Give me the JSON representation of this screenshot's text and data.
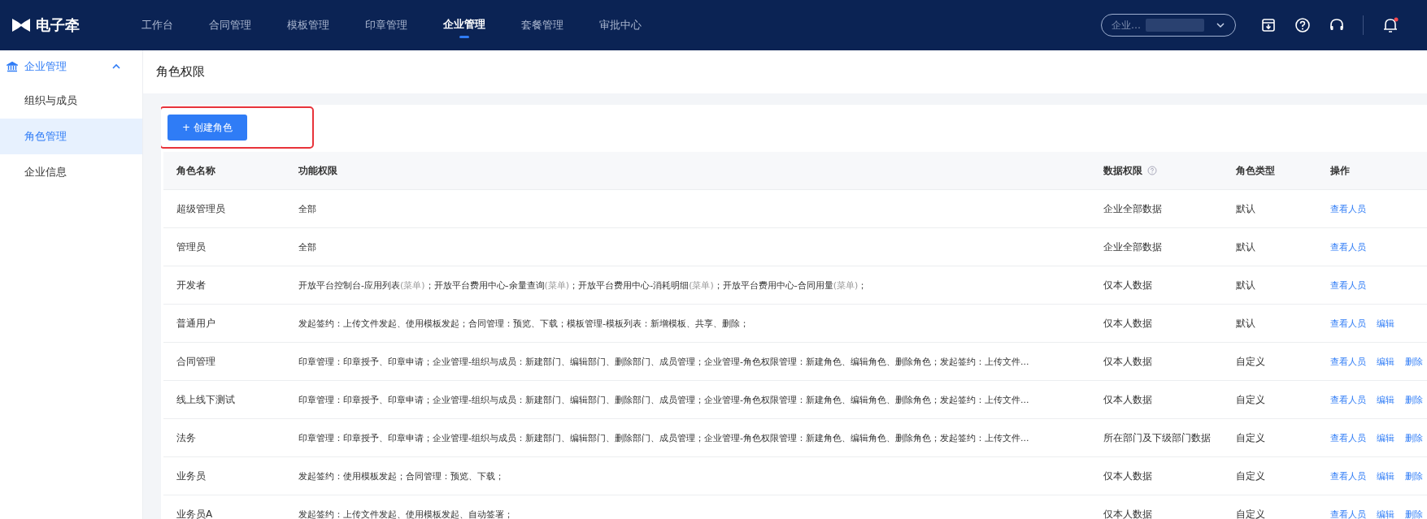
{
  "brand": {
    "name": "电子牵"
  },
  "nav": [
    {
      "label": "工作台",
      "selected": false
    },
    {
      "label": "合同管理",
      "selected": false
    },
    {
      "label": "模板管理",
      "selected": false
    },
    {
      "label": "印章管理",
      "selected": false
    },
    {
      "label": "企业管理",
      "selected": true
    },
    {
      "label": "套餐管理",
      "selected": false
    },
    {
      "label": "审批中心",
      "selected": false
    }
  ],
  "company_selector": {
    "value": "企业…"
  },
  "notifications": {
    "unread": true
  },
  "sidebar": {
    "group": {
      "label": "企业管理",
      "expanded": true,
      "children": [
        {
          "label": "组织与成员",
          "selected": false
        },
        {
          "label": "角色管理",
          "selected": true
        },
        {
          "label": "企业信息",
          "selected": false
        }
      ]
    }
  },
  "page_title": "角色权限",
  "create_button": {
    "label": "+ 创建角色",
    "highlighted": true
  },
  "table": {
    "columns": [
      {
        "label": "角色名称"
      },
      {
        "label": "功能权限"
      },
      {
        "label": "数据权限",
        "help": true
      },
      {
        "label": "角色类型"
      },
      {
        "label": "操作"
      }
    ],
    "rows": [
      {
        "name": "超级管理员",
        "permissions": [
          {
            "kind": "text",
            "text": "全部"
          }
        ],
        "data_scope": "企业全部数据",
        "type": "默认",
        "actions": [
          "查看人员"
        ]
      },
      {
        "name": "管理员",
        "permissions": [
          {
            "kind": "text",
            "text": "全部"
          }
        ],
        "data_scope": "企业全部数据",
        "type": "默认",
        "actions": [
          "查看人员"
        ]
      },
      {
        "name": "开发者",
        "permissions": [
          {
            "kind": "text",
            "text": "开放平台控制台-应用列表"
          },
          {
            "kind": "tag",
            "text": "(菜单)"
          },
          {
            "kind": "text",
            "text": "；开放平台费用中心-余量查询"
          },
          {
            "kind": "tag",
            "text": "(菜单)"
          },
          {
            "kind": "text",
            "text": "；开放平台费用中心-消耗明细"
          },
          {
            "kind": "tag",
            "text": "(菜单)"
          },
          {
            "kind": "text",
            "text": "；开放平台费用中心-合同用量"
          },
          {
            "kind": "tag",
            "text": "(菜单)"
          },
          {
            "kind": "text",
            "text": "；"
          }
        ],
        "data_scope": "仅本人数据",
        "type": "默认",
        "actions": [
          "查看人员"
        ]
      },
      {
        "name": "普通用户",
        "permissions": [
          {
            "kind": "text",
            "text": "发起签约：上传文件发起、使用模板发起；合同管理：预览、下载；模板管理-模板列表：新增模板、共享、删除；"
          }
        ],
        "data_scope": "仅本人数据",
        "type": "默认",
        "actions": [
          "查看人员",
          "编辑"
        ]
      },
      {
        "name": "合同管理",
        "permissions": [
          {
            "kind": "text",
            "text": "印章管理：印章授予、印章申请；企业管理-组织与成员：新建部门、编辑部门、删除部门、成员管理；企业管理-角色权限管理：新建角色、编辑角色、删除角色；发起签约：上传文件..."
          }
        ],
        "data_scope": "仅本人数据",
        "type": "自定义",
        "actions": [
          "查看人员",
          "编辑",
          "删除"
        ]
      },
      {
        "name": "线上线下测试",
        "permissions": [
          {
            "kind": "text",
            "text": "印章管理：印章授予、印章申请；企业管理-组织与成员：新建部门、编辑部门、删除部门、成员管理；企业管理-角色权限管理：新建角色、编辑角色、删除角色；发起签约：上传文件..."
          }
        ],
        "data_scope": "仅本人数据",
        "type": "自定义",
        "actions": [
          "查看人员",
          "编辑",
          "删除"
        ]
      },
      {
        "name": "法务",
        "permissions": [
          {
            "kind": "text",
            "text": "印章管理：印章授予、印章申请；企业管理-组织与成员：新建部门、编辑部门、删除部门、成员管理；企业管理-角色权限管理：新建角色、编辑角色、删除角色；发起签约：上传文件..."
          }
        ],
        "data_scope": "所在部门及下级部门数据",
        "type": "自定义",
        "actions": [
          "查看人员",
          "编辑",
          "删除"
        ]
      },
      {
        "name": "业务员",
        "permissions": [
          {
            "kind": "text",
            "text": "发起签约：使用模板发起；合同管理：预览、下载；"
          }
        ],
        "data_scope": "仅本人数据",
        "type": "自定义",
        "actions": [
          "查看人员",
          "编辑",
          "删除"
        ]
      },
      {
        "name": "业务员A",
        "permissions": [
          {
            "kind": "text",
            "text": "发起签约：上传文件发起、使用模板发起、自动签署；"
          }
        ],
        "data_scope": "仅本人数据",
        "type": "自定义",
        "actions": [
          "查看人员",
          "编辑",
          "删除"
        ]
      }
    ]
  }
}
